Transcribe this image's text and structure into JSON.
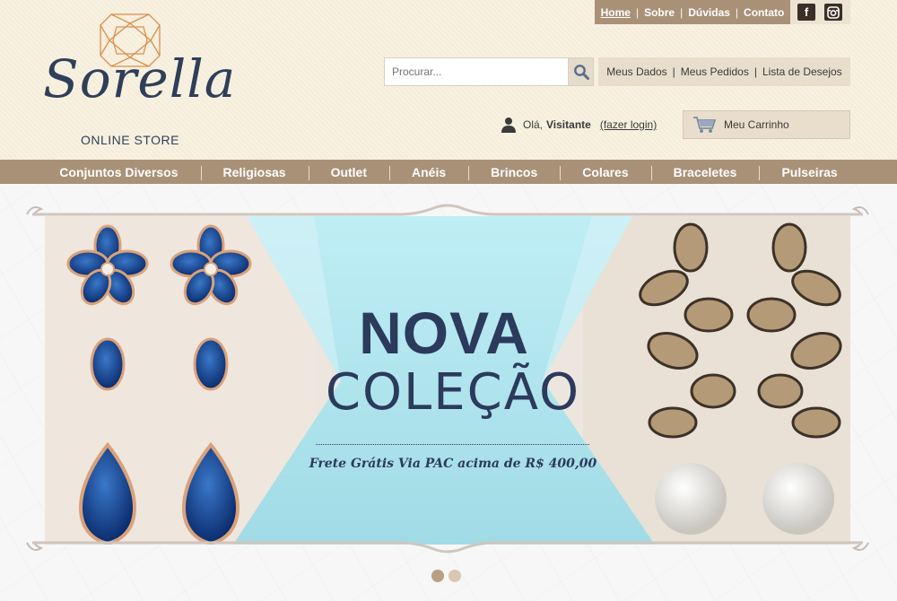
{
  "brand": {
    "name": "Sorella",
    "tagline": "ONLINE STORE"
  },
  "top_links": [
    {
      "label": "Home"
    },
    {
      "label": "Sobre"
    },
    {
      "label": "Dúvidas"
    },
    {
      "label": "Contato"
    }
  ],
  "social": {
    "facebook": "f",
    "instagram": "instagram-icon"
  },
  "search": {
    "placeholder": "Procurar..."
  },
  "account_links": [
    {
      "label": "Meus Dados"
    },
    {
      "label": "Meus Pedidos"
    },
    {
      "label": "Lista de Desejos"
    }
  ],
  "login": {
    "greeting": "Olá,",
    "user": "Visitante",
    "link": "(fazer login)"
  },
  "cart": {
    "label": "Meu Carrinho"
  },
  "nav": [
    {
      "label": "Conjuntos Diversos"
    },
    {
      "label": "Religiosas"
    },
    {
      "label": "Outlet"
    },
    {
      "label": "Anéis"
    },
    {
      "label": "Brincos"
    },
    {
      "label": "Colares"
    },
    {
      "label": "Braceletes"
    },
    {
      "label": "Pulseiras"
    }
  ],
  "banner": {
    "title": "NOVA",
    "subtitle": "COLEÇÃO",
    "promo": "Frete Grátis Via PAC acima de R$ 400,00"
  },
  "slider": {
    "total": 2,
    "active": 1
  },
  "colors": {
    "accent": "#a99178",
    "banner_text": "#2c3a5c",
    "teal": "#a8e0ea",
    "header_bg": "#f8f0de"
  }
}
